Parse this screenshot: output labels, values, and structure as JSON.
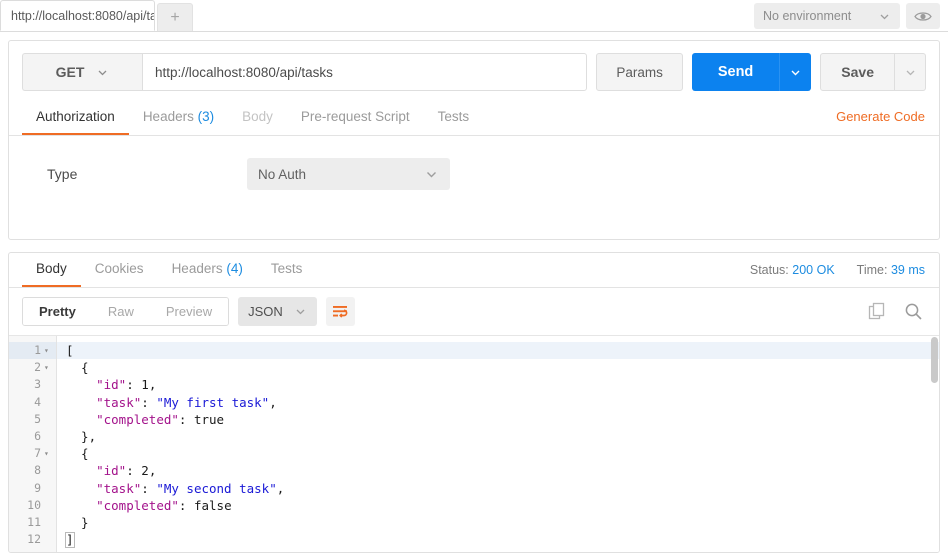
{
  "tabbar": {
    "request_tab_label": "http://localhost:8080/api/ta",
    "new_tab_label": "+",
    "environment_label": "No environment",
    "eye_icon": "eye-icon"
  },
  "request": {
    "method": "GET",
    "url": "http://localhost:8080/api/tasks",
    "params_label": "Params",
    "send_label": "Send",
    "save_label": "Save",
    "tabs": [
      {
        "label": "Authorization",
        "active": true,
        "count": "",
        "dim": false
      },
      {
        "label": "Headers",
        "active": false,
        "count": "(3)",
        "dim": false
      },
      {
        "label": "Body",
        "active": false,
        "count": "",
        "dim": true
      },
      {
        "label": "Pre-request Script",
        "active": false,
        "count": "",
        "dim": false
      },
      {
        "label": "Tests",
        "active": false,
        "count": "",
        "dim": false
      }
    ],
    "generate_code_label": "Generate Code",
    "auth": {
      "type_label": "Type",
      "type_value": "No Auth"
    }
  },
  "response": {
    "tabs": [
      {
        "label": "Body",
        "active": true,
        "count": ""
      },
      {
        "label": "Cookies",
        "active": false,
        "count": ""
      },
      {
        "label": "Headers",
        "active": false,
        "count": "(4)"
      },
      {
        "label": "Tests",
        "active": false,
        "count": ""
      }
    ],
    "status_label": "Status:",
    "status_value": "200 OK",
    "time_label": "Time:",
    "time_value": "39 ms",
    "format_tabs": [
      {
        "label": "Pretty",
        "active": true
      },
      {
        "label": "Raw",
        "active": false
      },
      {
        "label": "Preview",
        "active": false
      }
    ],
    "language": "JSON",
    "wrap_icon": "wrap-lines-icon",
    "copy_icon": "copy-icon",
    "search_icon": "search-icon",
    "body_lines": [
      {
        "num": "1",
        "fold": "▾",
        "highlight": true,
        "tokens": [
          {
            "t": "[",
            "c": "p"
          }
        ]
      },
      {
        "num": "2",
        "fold": "▾",
        "highlight": false,
        "tokens": [
          {
            "t": "  {",
            "c": "p"
          }
        ]
      },
      {
        "num": "3",
        "fold": "",
        "highlight": false,
        "tokens": [
          {
            "t": "    ",
            "c": "p"
          },
          {
            "t": "\"id\"",
            "c": "k"
          },
          {
            "t": ": ",
            "c": "p"
          },
          {
            "t": "1",
            "c": "n"
          },
          {
            "t": ",",
            "c": "p"
          }
        ]
      },
      {
        "num": "4",
        "fold": "",
        "highlight": false,
        "tokens": [
          {
            "t": "    ",
            "c": "p"
          },
          {
            "t": "\"task\"",
            "c": "k"
          },
          {
            "t": ": ",
            "c": "p"
          },
          {
            "t": "\"My first task\"",
            "c": "s"
          },
          {
            "t": ",",
            "c": "p"
          }
        ]
      },
      {
        "num": "5",
        "fold": "",
        "highlight": false,
        "tokens": [
          {
            "t": "    ",
            "c": "p"
          },
          {
            "t": "\"completed\"",
            "c": "k"
          },
          {
            "t": ": ",
            "c": "p"
          },
          {
            "t": "true",
            "c": "bool"
          }
        ]
      },
      {
        "num": "6",
        "fold": "",
        "highlight": false,
        "tokens": [
          {
            "t": "  },",
            "c": "p"
          }
        ]
      },
      {
        "num": "7",
        "fold": "▾",
        "highlight": false,
        "tokens": [
          {
            "t": "  {",
            "c": "p"
          }
        ]
      },
      {
        "num": "8",
        "fold": "",
        "highlight": false,
        "tokens": [
          {
            "t": "    ",
            "c": "p"
          },
          {
            "t": "\"id\"",
            "c": "k"
          },
          {
            "t": ": ",
            "c": "p"
          },
          {
            "t": "2",
            "c": "n"
          },
          {
            "t": ",",
            "c": "p"
          }
        ]
      },
      {
        "num": "9",
        "fold": "",
        "highlight": false,
        "tokens": [
          {
            "t": "    ",
            "c": "p"
          },
          {
            "t": "\"task\"",
            "c": "k"
          },
          {
            "t": ": ",
            "c": "p"
          },
          {
            "t": "\"My second task\"",
            "c": "s"
          },
          {
            "t": ",",
            "c": "p"
          }
        ]
      },
      {
        "num": "10",
        "fold": "",
        "highlight": false,
        "tokens": [
          {
            "t": "    ",
            "c": "p"
          },
          {
            "t": "\"completed\"",
            "c": "k"
          },
          {
            "t": ": ",
            "c": "p"
          },
          {
            "t": "false",
            "c": "bool"
          }
        ]
      },
      {
        "num": "11",
        "fold": "",
        "highlight": false,
        "tokens": [
          {
            "t": "  }",
            "c": "p"
          }
        ]
      },
      {
        "num": "12",
        "fold": "",
        "highlight": false,
        "tokens": [
          {
            "t": "]",
            "c": "p",
            "boxed": true
          }
        ]
      }
    ]
  },
  "colors": {
    "accent_orange": "#ef6c24",
    "send_blue": "#0c82ef",
    "link_blue": "#1d8ce0",
    "json_key": "#a3128b",
    "json_string": "#1a19d6"
  }
}
